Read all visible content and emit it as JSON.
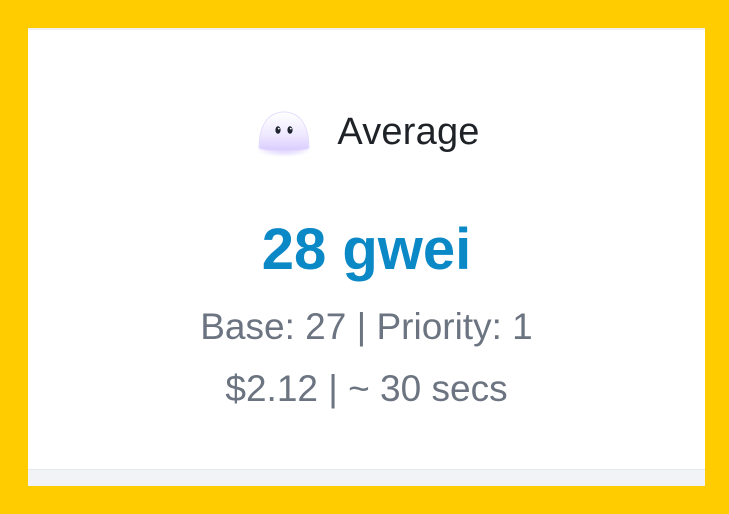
{
  "card": {
    "level_icon": "ghost-icon",
    "level_label": "Average",
    "gas_price": "28 gwei",
    "breakdown": "Base: 27 | Priority: 1",
    "cost_time": "$2.12 | ~ 30 secs"
  },
  "colors": {
    "background": "#FFCC00",
    "price": "#0b88c6",
    "secondary_text": "#6b7480"
  }
}
